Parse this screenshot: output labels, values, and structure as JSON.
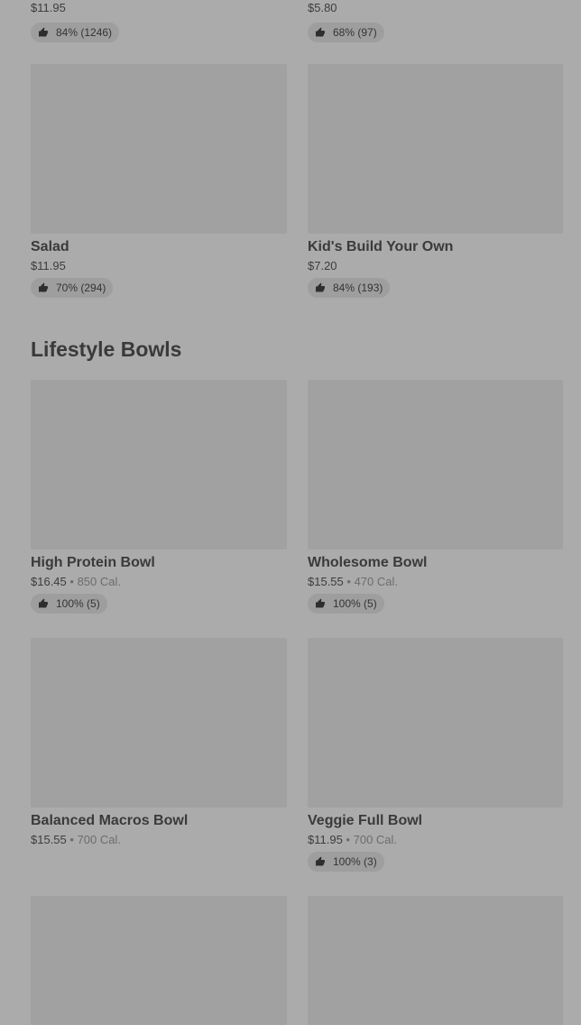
{
  "top_row": [
    {
      "price": "$11.95",
      "rating": "84% (1246)"
    },
    {
      "price": "$5.80",
      "rating": "68% (97)"
    }
  ],
  "row2": [
    {
      "name": "Salad",
      "price": "$11.95",
      "rating": "70% (294)"
    },
    {
      "name": "Kid's Build Your Own",
      "price": "$7.20",
      "rating": "84% (193)"
    }
  ],
  "section": {
    "title": "Lifestyle Bowls"
  },
  "lifestyle": [
    {
      "name": "High Protein Bowl",
      "price": "$16.45",
      "cal": "850 Cal.",
      "rating": "100% (5)"
    },
    {
      "name": "Wholesome Bowl",
      "price": "$15.55",
      "cal": "470 Cal.",
      "rating": "100% (5)"
    },
    {
      "name": "Balanced Macros Bowl",
      "price": "$15.55",
      "cal": "700 Cal."
    },
    {
      "name": "Veggie Full Bowl",
      "price": "$11.95",
      "cal": "700 Cal.",
      "rating": "100% (3)"
    }
  ],
  "separator": "•",
  "icons": {
    "rating": "thumbs-up-icon"
  }
}
